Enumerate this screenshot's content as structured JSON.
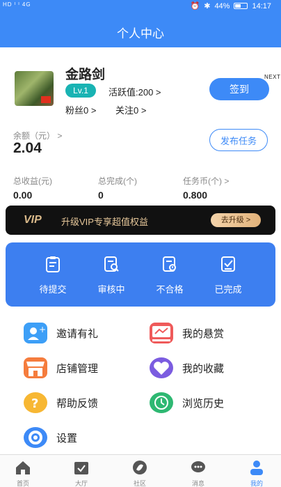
{
  "status_bar": {
    "left": "HD ᴵ ᴵ 4G",
    "battery": "44%",
    "time": "14:17"
  },
  "header": {
    "title": "个人中心"
  },
  "profile": {
    "username": "金路剑",
    "level": "Lv.1",
    "activity": "活跃值:200 >",
    "fans": "粉丝0 >",
    "follow": "关注0 >",
    "signin_label": "签到",
    "next_label": "NEXT"
  },
  "balance": {
    "label": "余额（元） >",
    "value": "2.04",
    "publish_label": "发布任务"
  },
  "stats": [
    {
      "label": "总收益(元)",
      "value": "0.00"
    },
    {
      "label": "总完成(个)",
      "value": "0"
    },
    {
      "label": "任务币(个) >",
      "value": "0.800"
    }
  ],
  "vip": {
    "logo": "VIP",
    "text": "升级VIP专享超值权益",
    "button": "去升级 >"
  },
  "tasks": [
    {
      "label": "待提交",
      "icon": "clipboard-icon"
    },
    {
      "label": "审核中",
      "icon": "search-doc-icon"
    },
    {
      "label": "不合格",
      "icon": "warning-doc-icon"
    },
    {
      "label": "已完成",
      "icon": "check-doc-icon"
    }
  ],
  "menu": [
    {
      "label": "邀请有礼",
      "icon": "invite-icon",
      "color": "#3d9ff7"
    },
    {
      "label": "我的悬赏",
      "icon": "reward-icon",
      "color": "#ef5a5a"
    },
    {
      "label": "店铺管理",
      "icon": "store-icon",
      "color": "#f57c3d"
    },
    {
      "label": "我的收藏",
      "icon": "heart-icon",
      "color": "#7b5ce0"
    },
    {
      "label": "帮助反馈",
      "icon": "help-icon",
      "color": "#f7b733"
    },
    {
      "label": "浏览历史",
      "icon": "history-icon",
      "color": "#2eb872"
    },
    {
      "label": "设置",
      "icon": "settings-icon",
      "color": "#3d8af7"
    }
  ],
  "tabs": [
    {
      "label": "首页",
      "icon": "home-icon"
    },
    {
      "label": "大厅",
      "icon": "calendar-icon"
    },
    {
      "label": "社区",
      "icon": "community-icon"
    },
    {
      "label": "消息",
      "icon": "message-icon"
    },
    {
      "label": "我的",
      "icon": "user-icon"
    }
  ]
}
